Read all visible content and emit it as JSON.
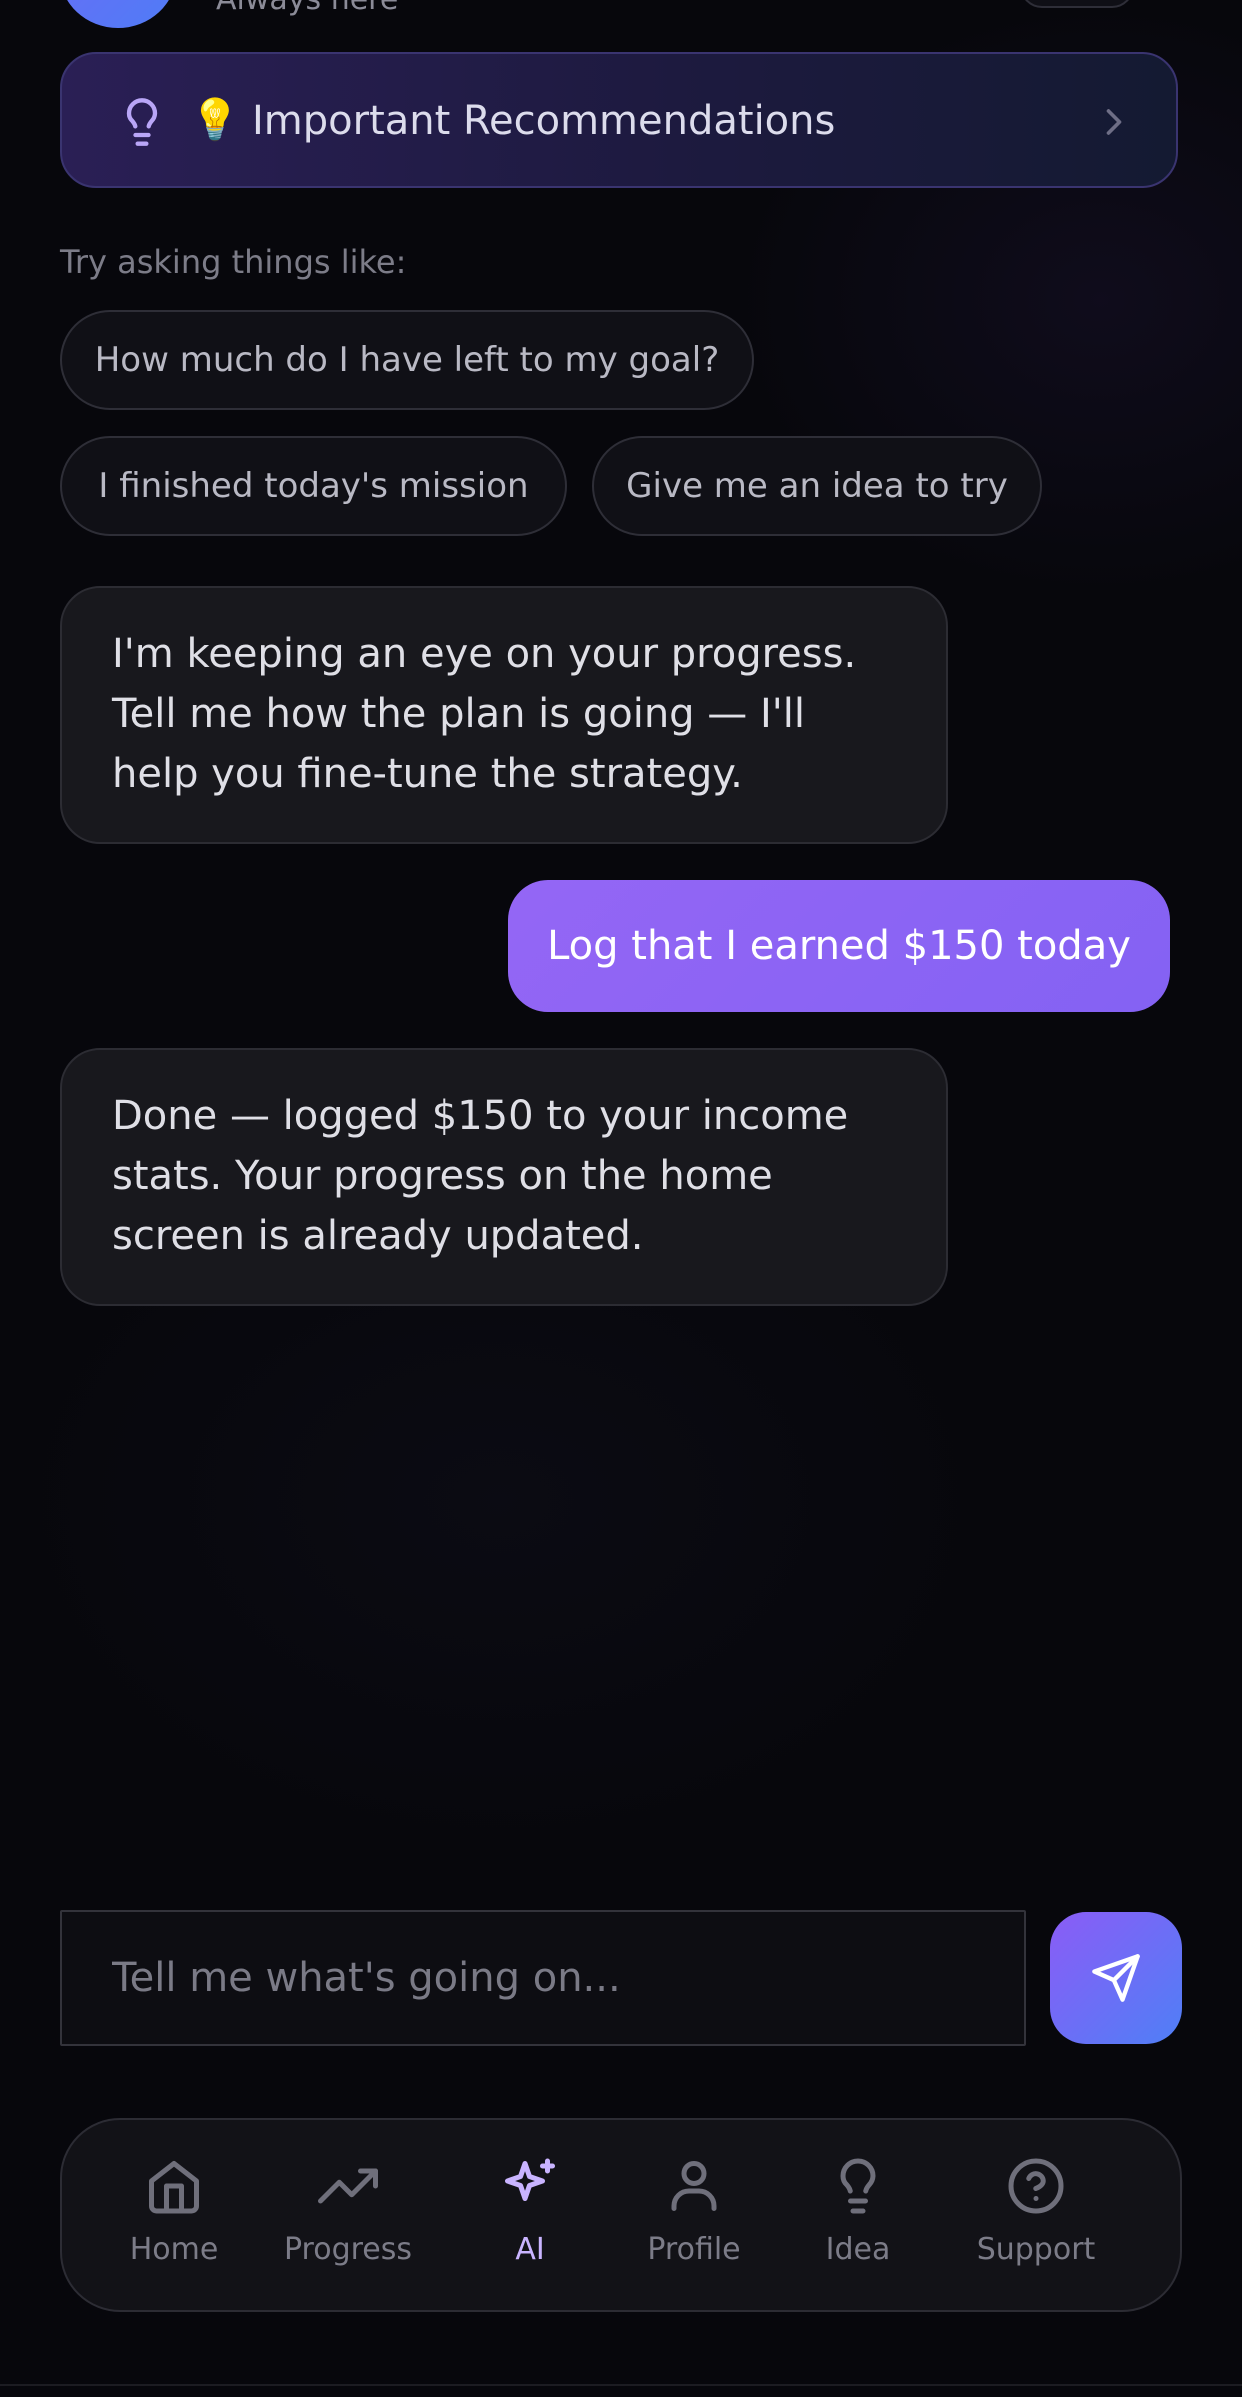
{
  "header": {
    "subtitle": "Always here"
  },
  "recommendations": {
    "emoji": "💡",
    "label": "Important Recommendations"
  },
  "hint": "Try asking things like:",
  "suggestions": [
    "How much do I have left to my goal?",
    "I finished today's mission",
    "Give me an idea to try"
  ],
  "messages": [
    {
      "role": "assistant",
      "text": "I'm keeping an eye on your progress. Tell me how the plan is going — I'll help you fine-tune the strategy."
    },
    {
      "role": "user",
      "text": "Log that I earned $150 today"
    },
    {
      "role": "assistant",
      "text": "Done — logged $150 to your income stats. Your progress on the home screen is already updated."
    }
  ],
  "composer": {
    "placeholder": "Tell me what's going on..."
  },
  "nav": {
    "active": "AI",
    "items": [
      {
        "label": "Home",
        "icon": "home-icon"
      },
      {
        "label": "Progress",
        "icon": "trending-up-icon"
      },
      {
        "label": "AI",
        "icon": "sparkles-icon"
      },
      {
        "label": "Profile",
        "icon": "user-icon"
      },
      {
        "label": "Idea",
        "icon": "lightbulb-icon"
      },
      {
        "label": "Support",
        "icon": "help-circle-icon"
      }
    ]
  },
  "colors": {
    "accent": "#8b5cf6",
    "accent_blue": "#4f7ff6",
    "background": "#07070c",
    "active_nav": "#c9b4ff"
  }
}
